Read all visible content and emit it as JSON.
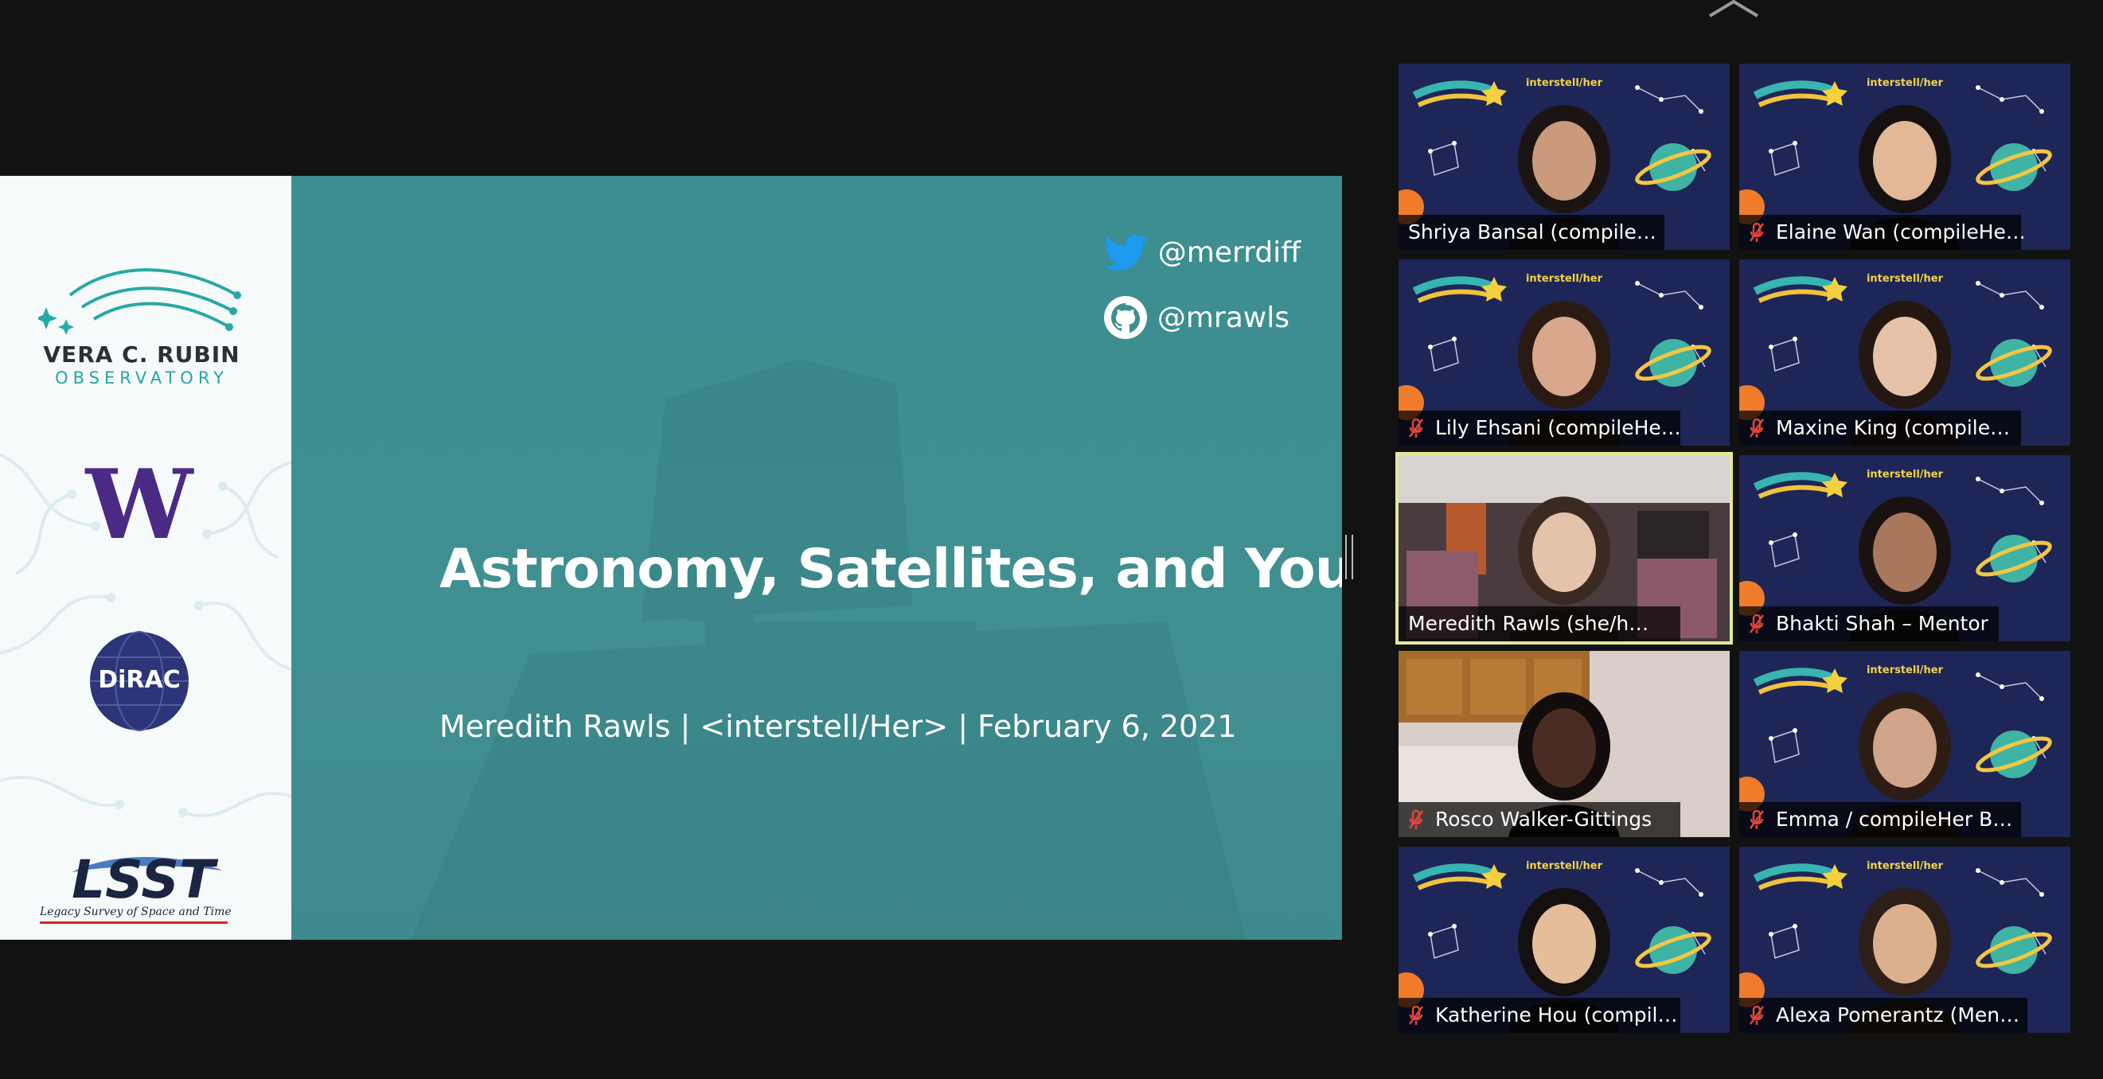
{
  "slide": {
    "title": "Astronomy, Satellites, and You",
    "subtitle": "Meredith Rawls | <interstell/Her> | February 6, 2021",
    "twitter_handle": "@merrdiff",
    "github_handle": "@mrawls",
    "logos": {
      "rubin_name": "VERA C. RUBIN",
      "rubin_sub": "OBSERVATORY",
      "uw": "W",
      "dirac": "DiRAC",
      "lsst": "LSST",
      "lsst_sub": "Legacy Survey of Space and Time"
    },
    "colors": {
      "slide_teal": "#3f8f91",
      "logo_panel": "#f7fafa",
      "uw_purple": "#4b2a85"
    }
  },
  "gallery": {
    "participants": [
      {
        "name": "Shriya Bansal (compile…",
        "muted": false,
        "video": "interstell-her-background",
        "banner": "interstell/her"
      },
      {
        "name": "Elaine Wan (compileHe…",
        "muted": true,
        "video": "interstell-her-background",
        "banner": "interstell/her"
      },
      {
        "name": "Lily Ehsani (compileHe…",
        "muted": true,
        "video": "interstell-her-background",
        "banner": "interstell/her"
      },
      {
        "name": "Maxine King (compile…",
        "muted": true,
        "video": "interstell-her-background",
        "banner": "interstell/her"
      },
      {
        "name": "Meredith Rawls (she/h…",
        "muted": false,
        "video": "room-background",
        "active_speaker": true
      },
      {
        "name": "Bhakti Shah – Mentor",
        "muted": true,
        "video": "interstell-her-background",
        "banner": "interstell/her"
      },
      {
        "name": "Rosco Walker-Gittings",
        "muted": true,
        "video": "kitchen-background"
      },
      {
        "name": "Emma / compileHer B…",
        "muted": true,
        "video": "interstell-her-background",
        "banner": "interstell/her"
      },
      {
        "name": "Katherine Hou (compil…",
        "muted": true,
        "video": "interstell-her-background",
        "banner": "interstell/her"
      },
      {
        "name": "Alexa Pomerantz (Men…",
        "muted": true,
        "video": "interstell-her-background",
        "banner": "interstell/her"
      }
    ]
  },
  "colors": {
    "background": "#121212",
    "active_speaker_border": "#e1ea9b",
    "muted_icon": "#e0453a"
  }
}
